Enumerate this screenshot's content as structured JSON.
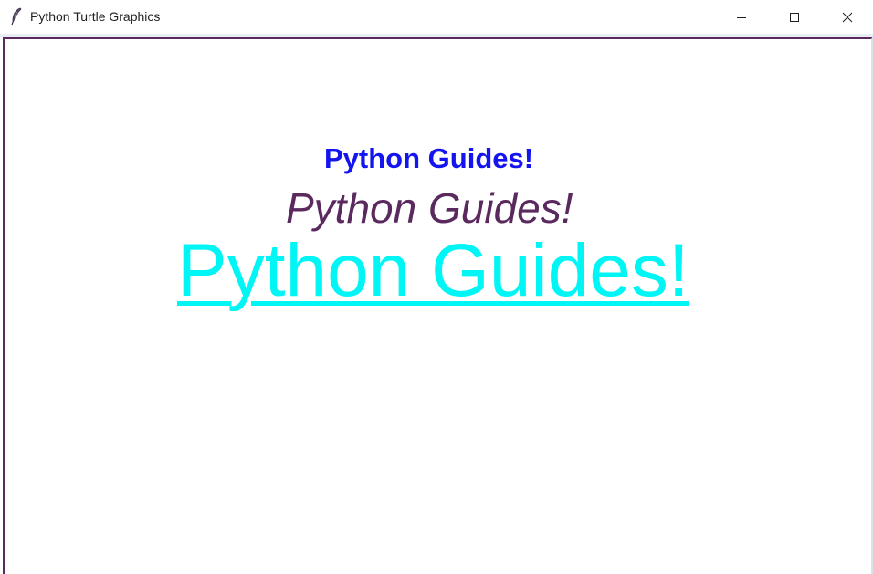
{
  "window": {
    "title": "Python Turtle Graphics",
    "controls": {
      "minimize": "minimize-icon",
      "maximize": "maximize-icon",
      "close": "close-icon"
    }
  },
  "canvas": {
    "texts": [
      {
        "text": "Python Guides!",
        "color": "#1414f0",
        "style": "bold"
      },
      {
        "text": "Python Guides!",
        "color": "#5a2a5e",
        "style": "italic"
      },
      {
        "text": "Python Guides!",
        "color": "#00f5f5",
        "style": "underline"
      }
    ]
  }
}
